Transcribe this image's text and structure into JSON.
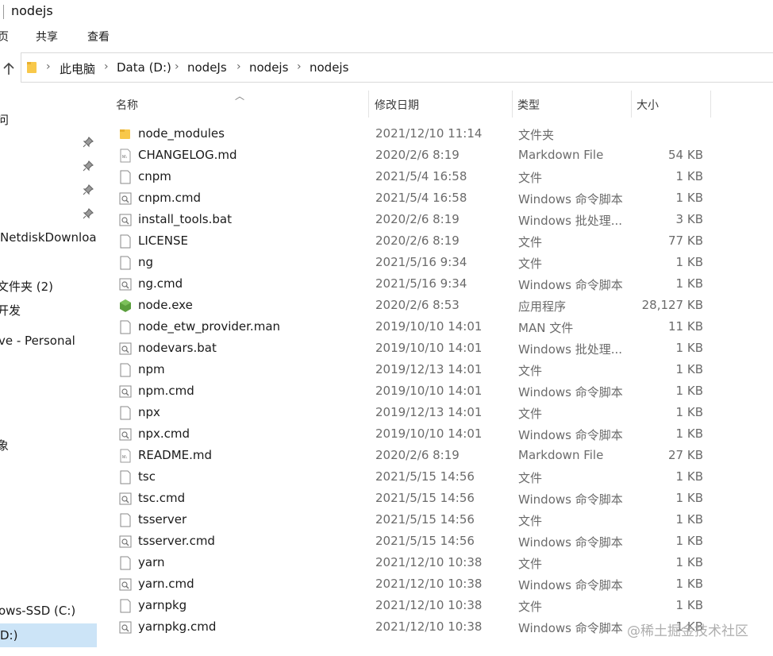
{
  "window": {
    "title": "nodejs"
  },
  "ribbon": {
    "tabs": [
      "页",
      "共享",
      "查看"
    ]
  },
  "address": {
    "crumbs": [
      "此电脑",
      "Data (D:)",
      "nodeJs",
      "nodejs",
      "nodejs"
    ]
  },
  "sidebar": {
    "items": [
      "问",
      "NetdiskDownload",
      "文件夹 (2)",
      "开发",
      "ve - Personal",
      "象",
      "ows-SSD (C:)",
      "D:)"
    ]
  },
  "columns": {
    "name": "名称",
    "date": "修改日期",
    "type": "类型",
    "size": "大小"
  },
  "files": [
    {
      "name": "node_modules",
      "date": "2021/12/10 11:14",
      "type": "文件夹",
      "size": "",
      "icon": "folder-icon"
    },
    {
      "name": "CHANGELOG.md",
      "date": "2020/2/6 8:19",
      "type": "Markdown File",
      "size": "54 KB",
      "icon": "markdown-file-icon"
    },
    {
      "name": "cnpm",
      "date": "2021/5/4 16:58",
      "type": "文件",
      "size": "1 KB",
      "icon": "file-icon"
    },
    {
      "name": "cnpm.cmd",
      "date": "2021/5/4 16:58",
      "type": "Windows 命令脚本",
      "size": "1 KB",
      "icon": "script-file-icon"
    },
    {
      "name": "install_tools.bat",
      "date": "2020/2/6 8:19",
      "type": "Windows 批处理...",
      "size": "3 KB",
      "icon": "script-file-icon"
    },
    {
      "name": "LICENSE",
      "date": "2020/2/6 8:19",
      "type": "文件",
      "size": "77 KB",
      "icon": "file-icon"
    },
    {
      "name": "ng",
      "date": "2021/5/16 9:34",
      "type": "文件",
      "size": "1 KB",
      "icon": "file-icon"
    },
    {
      "name": "ng.cmd",
      "date": "2021/5/16 9:34",
      "type": "Windows 命令脚本",
      "size": "1 KB",
      "icon": "script-file-icon"
    },
    {
      "name": "node.exe",
      "date": "2020/2/6 8:53",
      "type": "应用程序",
      "size": "28,127 KB",
      "icon": "node-app-icon"
    },
    {
      "name": "node_etw_provider.man",
      "date": "2019/10/10 14:01",
      "type": "MAN 文件",
      "size": "11 KB",
      "icon": "file-icon"
    },
    {
      "name": "nodevars.bat",
      "date": "2019/10/10 14:01",
      "type": "Windows 批处理...",
      "size": "1 KB",
      "icon": "script-file-icon"
    },
    {
      "name": "npm",
      "date": "2019/12/13 14:01",
      "type": "文件",
      "size": "1 KB",
      "icon": "file-icon"
    },
    {
      "name": "npm.cmd",
      "date": "2019/10/10 14:01",
      "type": "Windows 命令脚本",
      "size": "1 KB",
      "icon": "script-file-icon"
    },
    {
      "name": "npx",
      "date": "2019/12/13 14:01",
      "type": "文件",
      "size": "1 KB",
      "icon": "file-icon"
    },
    {
      "name": "npx.cmd",
      "date": "2019/10/10 14:01",
      "type": "Windows 命令脚本",
      "size": "1 KB",
      "icon": "script-file-icon"
    },
    {
      "name": "README.md",
      "date": "2020/2/6 8:19",
      "type": "Markdown File",
      "size": "27 KB",
      "icon": "markdown-file-icon"
    },
    {
      "name": "tsc",
      "date": "2021/5/15 14:56",
      "type": "文件",
      "size": "1 KB",
      "icon": "file-icon"
    },
    {
      "name": "tsc.cmd",
      "date": "2021/5/15 14:56",
      "type": "Windows 命令脚本",
      "size": "1 KB",
      "icon": "script-file-icon"
    },
    {
      "name": "tsserver",
      "date": "2021/5/15 14:56",
      "type": "文件",
      "size": "1 KB",
      "icon": "file-icon"
    },
    {
      "name": "tsserver.cmd",
      "date": "2021/5/15 14:56",
      "type": "Windows 命令脚本",
      "size": "1 KB",
      "icon": "script-file-icon"
    },
    {
      "name": "yarn",
      "date": "2021/12/10 10:38",
      "type": "文件",
      "size": "1 KB",
      "icon": "file-icon"
    },
    {
      "name": "yarn.cmd",
      "date": "2021/12/10 10:38",
      "type": "Windows 命令脚本",
      "size": "1 KB",
      "icon": "script-file-icon"
    },
    {
      "name": "yarnpkg",
      "date": "2021/12/10 10:38",
      "type": "文件",
      "size": "1 KB",
      "icon": "file-icon"
    },
    {
      "name": "yarnpkg.cmd",
      "date": "2021/12/10 10:38",
      "type": "Windows 命令脚本",
      "size": "1 KB",
      "icon": "script-file-icon"
    }
  ],
  "watermark": "@稀土掘金技术社区",
  "colors": {
    "folder": "#f8c84a",
    "node": "#5a9e3c",
    "selection": "#cce4f7"
  }
}
